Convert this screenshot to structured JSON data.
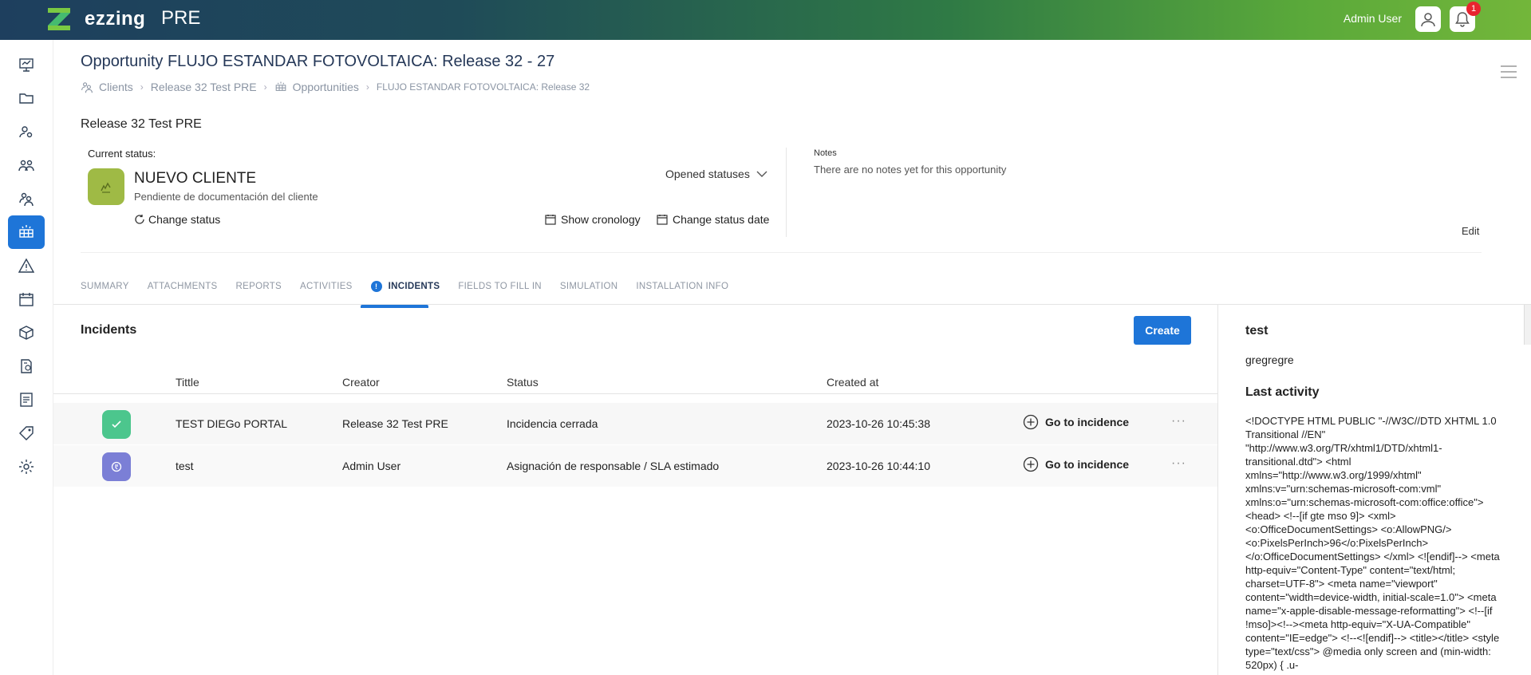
{
  "topbar": {
    "brand": "ezzing",
    "env": "PRE",
    "user_name": "Admin User",
    "notifications_count": "1"
  },
  "header": {
    "title": "Opportunity FLUJO ESTANDAR FOTOVOLTAICA: Release 32 - 27",
    "breadcrumb": {
      "clients": "Clients",
      "client": "Release 32 Test PRE",
      "opportunities": "Opportunities",
      "current": "FLUJO ESTANDAR FOTOVOLTAICA: Release 32"
    }
  },
  "summary": {
    "client_name": "Release 32 Test PRE",
    "current_status_label": "Current status:",
    "status_name": "NUEVO CLIENTE",
    "status_description": "Pendiente de documentación del cliente",
    "opened_statuses": "Opened statuses",
    "change_status": "Change status",
    "show_cronology": "Show cronology",
    "change_status_date": "Change status date",
    "notes_label": "Notes",
    "notes_text": "There are no notes yet for this opportunity",
    "edit": "Edit"
  },
  "tabs": [
    {
      "label": "SUMMARY"
    },
    {
      "label": "ATTACHMENTS"
    },
    {
      "label": "REPORTS"
    },
    {
      "label": "ACTIVITIES"
    },
    {
      "label": "INCIDENTS",
      "badge": "!"
    },
    {
      "label": "FIELDS TO FILL IN"
    },
    {
      "label": "SIMULATION"
    },
    {
      "label": "INSTALLATION INFO"
    }
  ],
  "incidents": {
    "title": "Incidents",
    "create_label": "Create",
    "columns": {
      "title": "Tittle",
      "creator": "Creator",
      "status": "Status",
      "created_at": "Created at"
    },
    "rows": [
      {
        "title": "TEST DIEGo PORTAL",
        "creator": "Release 32 Test PRE",
        "status": "Incidencia cerrada",
        "created_at": "2023-10-26 10:45:38",
        "action": "Go to incidence",
        "more": "···",
        "icon": "check-icon",
        "color": "#4cc68d"
      },
      {
        "title": "test",
        "creator": "Admin User",
        "status": "Asignación de responsable / SLA estimado",
        "created_at": "2023-10-26 10:44:10",
        "action": "Go to incidence",
        "more": "···",
        "icon": "hand-icon",
        "color": "#7b7fd6"
      }
    ]
  },
  "detail": {
    "title": "test",
    "description": "gregregre",
    "last_activity_label": "Last activity",
    "last_activity_html": "<!DOCTYPE HTML PUBLIC \"-//W3C//DTD XHTML 1.0 Transitional //EN\" \"http://www.w3.org/TR/xhtml1/DTD/xhtml1-transitional.dtd\"> <html xmlns=\"http://www.w3.org/1999/xhtml\" xmlns:v=\"urn:schemas-microsoft-com:vml\" xmlns:o=\"urn:schemas-microsoft-com:office:office\"> <head> <!--[if gte mso 9]> <xml> <o:OfficeDocumentSettings> <o:AllowPNG/> <o:PixelsPerInch>96</o:PixelsPerInch> </o:OfficeDocumentSettings> </xml> <![endif]--> <meta http-equiv=\"Content-Type\" content=\"text/html; charset=UTF-8\"> <meta name=\"viewport\" content=\"width=device-width, initial-scale=1.0\"> <meta name=\"x-apple-disable-message-reformatting\"> <!--[if !mso]><!--><meta http-equiv=\"X-UA-Compatible\" content=\"IE=edge\"> <!--<![endif]--> <title></title> <style type=\"text/css\"> @media only screen and (min-width: 520px) { .u-"
  },
  "colors": {
    "accent": "#1e75d8",
    "status_tile": "#9fba45"
  }
}
